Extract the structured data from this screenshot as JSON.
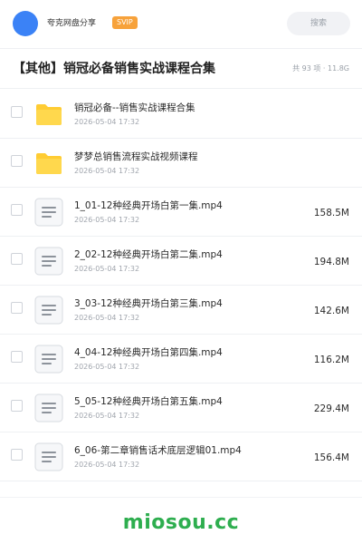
{
  "header": {
    "user_name": "夸克网盘分享",
    "badge": "SVIP",
    "search_label": "搜索"
  },
  "share": {
    "title": "【其他】销冠必备销售实战课程合集",
    "meta": "共 93 项 · 11.8G"
  },
  "colors": {
    "accent": "#3b82f6",
    "badge": "#f7a23b",
    "folder": "#ffcc33",
    "watermark": "#2eae4f"
  },
  "files": [
    {
      "type": "folder",
      "icon": "folder-icon",
      "name": "销冠必备--销售实战课程合集",
      "date": "2026-05-04 17:32",
      "size": ""
    },
    {
      "type": "folder",
      "icon": "folder-icon",
      "name": "梦梦总销售流程实战视频课程",
      "date": "2026-05-04 17:32",
      "size": ""
    },
    {
      "type": "file",
      "icon": "document-icon",
      "name": "1_01-12种经典开场白第一集.mp4",
      "date": "2026-05-04 17:32",
      "size": "158.5M"
    },
    {
      "type": "file",
      "icon": "document-icon",
      "name": "2_02-12种经典开场白第二集.mp4",
      "date": "2026-05-04 17:32",
      "size": "194.8M"
    },
    {
      "type": "file",
      "icon": "document-icon",
      "name": "3_03-12种经典开场白第三集.mp4",
      "date": "2026-05-04 17:32",
      "size": "142.6M"
    },
    {
      "type": "file",
      "icon": "document-icon",
      "name": "4_04-12种经典开场白第四集.mp4",
      "date": "2026-05-04 17:32",
      "size": "116.2M"
    },
    {
      "type": "file",
      "icon": "document-icon",
      "name": "5_05-12种经典开场白第五集.mp4",
      "date": "2026-05-04 17:32",
      "size": "229.4M"
    },
    {
      "type": "file",
      "icon": "document-icon",
      "name": "6_06-第二章销售话术底层逻辑01.mp4",
      "date": "2026-05-04 17:32",
      "size": "156.4M"
    }
  ],
  "footer": {
    "watermark": "miosou.cc"
  }
}
